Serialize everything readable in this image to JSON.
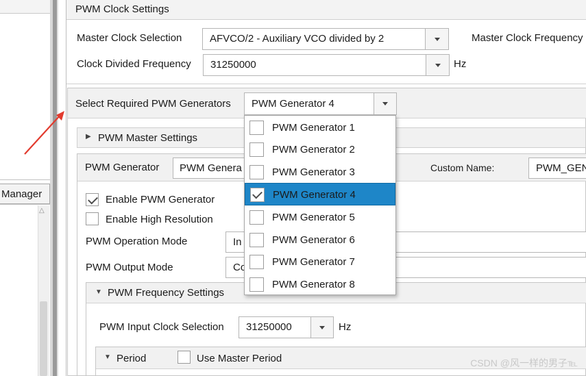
{
  "left_pane": {
    "manager_tab_label": "Manager"
  },
  "clock_settings": {
    "header": "PWM Clock Settings",
    "master_clock_label": "Master Clock Selection",
    "master_clock_value": "AFVCO/2 - Auxiliary VCO divided by 2",
    "master_clock_freq_label": "Master Clock Frequency",
    "clock_divided_label": "Clock Divided Frequency",
    "clock_divided_value": "31250000",
    "clock_divided_unit": "Hz"
  },
  "generators": {
    "select_label": "Select Required PWM Generators",
    "select_value": "PWM Generator 4",
    "options": [
      {
        "label": "PWM Generator 1",
        "checked": false,
        "selected": false
      },
      {
        "label": "PWM Generator 2",
        "checked": false,
        "selected": false
      },
      {
        "label": "PWM Generator 3",
        "checked": false,
        "selected": false
      },
      {
        "label": "PWM Generator 4",
        "checked": true,
        "selected": true
      },
      {
        "label": "PWM Generator 5",
        "checked": false,
        "selected": false
      },
      {
        "label": "PWM Generator 6",
        "checked": false,
        "selected": false
      },
      {
        "label": "PWM Generator 7",
        "checked": false,
        "selected": false
      },
      {
        "label": "PWM Generator 8",
        "checked": false,
        "selected": false
      }
    ]
  },
  "master_settings": {
    "header": "PWM Master Settings"
  },
  "generator_panel": {
    "label": "PWM Generator",
    "value": "PWM Genera",
    "custom_name_label": "Custom Name:",
    "custom_name_value": "PWM_GEN",
    "enable_generator_label": "Enable PWM Generator",
    "enable_generator_checked": true,
    "enable_high_res_label": "Enable High Resolution",
    "enable_high_res_checked": false,
    "operation_mode_label": "PWM Operation Mode",
    "operation_mode_value": "In",
    "output_mode_label": "PWM Output Mode",
    "output_mode_value": "Co"
  },
  "frequency_settings": {
    "header": "PWM Frequency Settings",
    "input_clock_label": "PWM Input Clock Selection",
    "input_clock_value": "31250000",
    "input_clock_unit": "Hz",
    "period_header": "Period",
    "use_master_period_label": "Use Master Period"
  },
  "watermark": "CSDN @风一样的男子℡",
  "colors": {
    "selection": "#1e86c8",
    "arrow": "#e23b2e",
    "header_bg": "#f3f3f3"
  }
}
